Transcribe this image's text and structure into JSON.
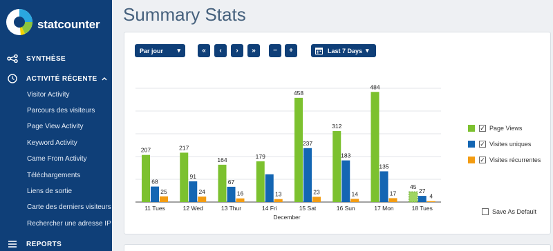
{
  "sidebar": {
    "brand": "statcounter",
    "sections": [
      {
        "label": "SYNTHÈSE",
        "icon": "network-icon"
      },
      {
        "label": "ACTIVITÉ RÉCENTE",
        "icon": "clock-icon"
      },
      {
        "label": "REPORTS",
        "icon": "menu-icon"
      }
    ],
    "items": [
      "Visitor Activity",
      "Parcours des visiteurs",
      "Page View Activity",
      "Keyword Activity",
      "Came From Activity",
      "Téléchargements",
      "Liens de sortie",
      "Carte des derniers visiteurs",
      "Rechercher une adresse IP"
    ]
  },
  "main": {
    "title": "Summary Stats"
  },
  "toolbar": {
    "period_select": "Par jour",
    "nav_first": "«",
    "nav_prev": "‹",
    "nav_next": "›",
    "nav_last": "»",
    "zoom_out": "−",
    "zoom_in": "+",
    "date_range": "Last 7 Days",
    "dropdown_caret": "▾"
  },
  "colors": {
    "page_views": "#7cc12f",
    "unique": "#1466b3",
    "returning": "#f39c12",
    "sidebar": "#0f3f78"
  },
  "legend": [
    {
      "label": "Page Views",
      "checked": true
    },
    {
      "label": "Visites uniques",
      "checked": true
    },
    {
      "label": "Visites récurrentes",
      "checked": true
    }
  ],
  "save_default": "Save As Default",
  "chart_data": {
    "type": "bar",
    "categories": [
      "11 Tues",
      "12 Wed",
      "13 Thur",
      "14 Fri",
      "15 Sat",
      "16 Sun",
      "17 Mon",
      "18 Tues"
    ],
    "xlabel": "December",
    "series": [
      {
        "name": "Page Views",
        "values": [
          207,
          217,
          164,
          179,
          458,
          312,
          484,
          45
        ]
      },
      {
        "name": "Visites uniques",
        "values": [
          68,
          91,
          67,
          122,
          237,
          183,
          135,
          27
        ]
      },
      {
        "name": "Visites récurrentes",
        "values": [
          25,
          24,
          16,
          13,
          23,
          14,
          17,
          4
        ]
      }
    ],
    "data_labels": [
      [
        "207",
        "217",
        "164",
        "179",
        "458",
        "312",
        "484",
        "45"
      ],
      [
        "68",
        "91",
        "67",
        "",
        "237",
        "183",
        "135",
        "27"
      ],
      [
        "25",
        "24",
        "16",
        "13",
        "23",
        "14",
        "17",
        "4"
      ]
    ],
    "ylim": [
      0,
      500
    ],
    "grid": true,
    "legend_position": "right",
    "last_category_partial": true
  }
}
